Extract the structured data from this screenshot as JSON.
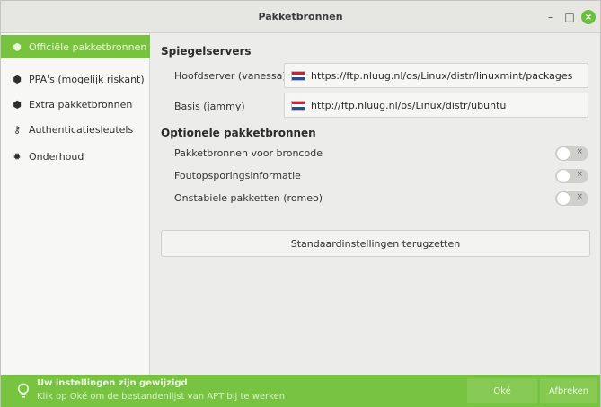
{
  "window": {
    "title": "Pakketbronnen"
  },
  "sidebar": {
    "items": [
      {
        "label": "Officiële pakketbronnen",
        "icon": "package-icon"
      },
      {
        "label": "PPA's (mogelijk riskant)",
        "icon": "package-icon"
      },
      {
        "label": "Extra pakketbronnen",
        "icon": "package-icon"
      },
      {
        "label": "Authenticatiesleutels",
        "icon": "key-icon"
      },
      {
        "label": "Onderhoud",
        "icon": "gear-icon"
      }
    ],
    "active_index": 0
  },
  "mirrors": {
    "title": "Spiegelservers",
    "main": {
      "label": "Hoofdserver (vanessa)",
      "value": "https://ftp.nluug.nl/os/Linux/distr/linuxmint/packages"
    },
    "base": {
      "label": "Basis (jammy)",
      "value": "http://ftp.nluug.nl/os/Linux/distr/ubuntu"
    }
  },
  "optional": {
    "title": "Optionele pakketbronnen",
    "items": [
      {
        "label": "Pakketbronnen voor broncode",
        "enabled": false
      },
      {
        "label": "Foutopsporingsinformatie",
        "enabled": false
      },
      {
        "label": "Onstabiele pakketten (romeo)",
        "enabled": false
      }
    ]
  },
  "reset_button": "Standaardinstellingen terugzetten",
  "infobar": {
    "title": "Uw instellingen zijn gewijzigd",
    "subtitle": "Klik op Oké om de bestandenlijst van APT bij te werken",
    "ok": "Oké",
    "cancel": "Afbreken"
  },
  "colors": {
    "accent": "#77c33e"
  }
}
